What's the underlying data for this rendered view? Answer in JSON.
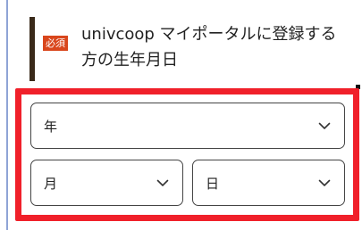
{
  "question": {
    "badge": "必須",
    "label": "univcoop マイポータルに登録する方の生年月日"
  },
  "birthdate": {
    "year_select": {
      "selected": "年",
      "icon": "chevron-down-icon"
    },
    "month_select": {
      "selected": "月",
      "icon": "chevron-down-icon"
    },
    "day_select": {
      "selected": "日",
      "icon": "chevron-down-icon"
    }
  },
  "colors": {
    "badge_bg": "#d9461c",
    "accent_bar": "#3a2a1a",
    "highlight": "#f0202a",
    "left_rule": "#8fa4d6"
  }
}
